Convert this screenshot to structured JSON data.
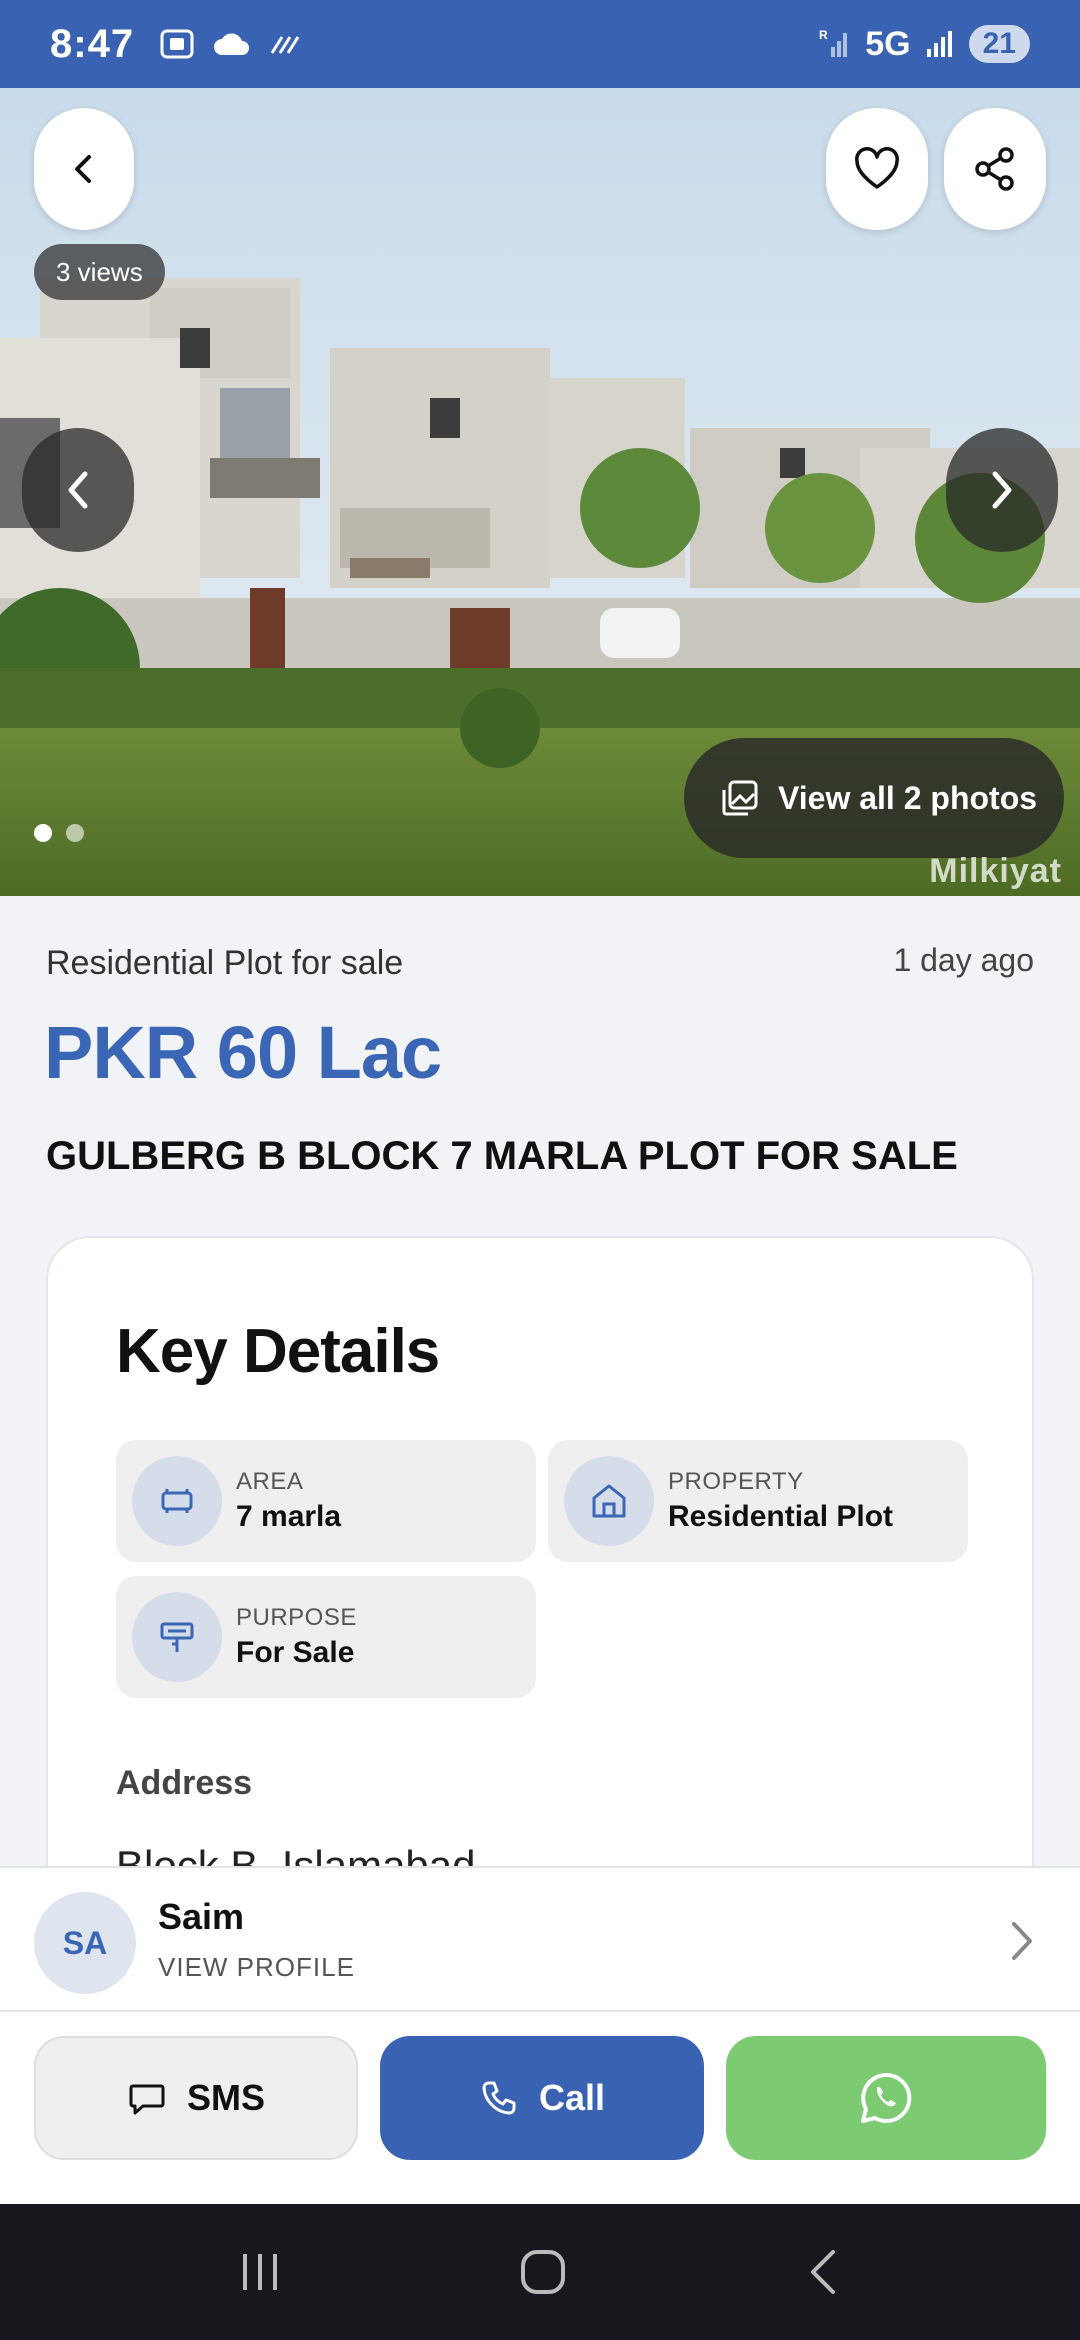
{
  "status_bar": {
    "time": "8:47",
    "network": "5G",
    "battery": "21"
  },
  "hero": {
    "views": "3 views",
    "view_all": "View all 2 photos",
    "watermark": "Milkiyat",
    "photo_index": 1,
    "photo_count": 2
  },
  "listing": {
    "type": "Residential Plot for sale",
    "posted": "1 day ago",
    "price": "PKR 60 Lac",
    "title": "GULBERG B BLOCK 7 MARLA PLOT FOR SALE"
  },
  "key_details": {
    "heading": "Key Details",
    "area": {
      "label": "AREA",
      "value": "7 marla"
    },
    "property": {
      "label": "PROPERTY",
      "value": "Residential Plot"
    },
    "purpose": {
      "label": "PURPOSE",
      "value": "For Sale"
    },
    "address_label": "Address",
    "address_value": "Block B, Islamabad"
  },
  "agent": {
    "initials": "SA",
    "name": "Saim",
    "link": "VIEW PROFILE"
  },
  "actions": {
    "sms": "SMS",
    "call": "Call"
  },
  "colors": {
    "brand": "#3a62b2",
    "price": "#3b66b5",
    "whatsapp": "#7ccb72"
  }
}
